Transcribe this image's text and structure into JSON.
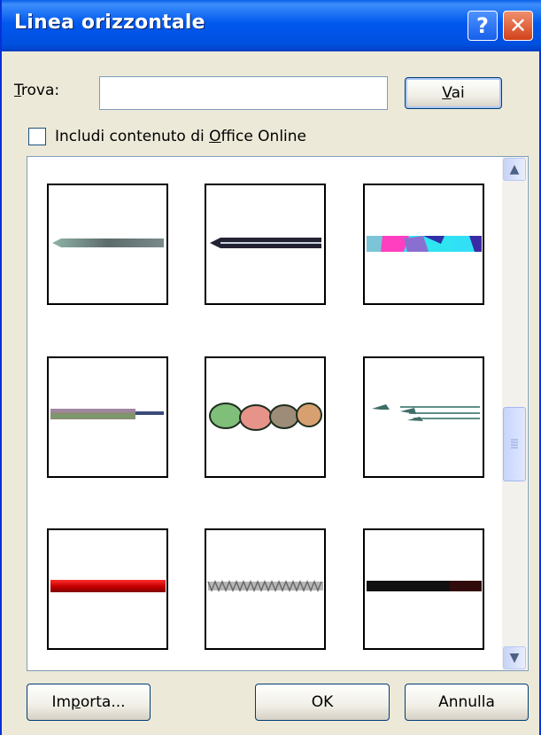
{
  "window": {
    "title": "Linea orizzontale"
  },
  "titlebar_buttons": {
    "help": "?",
    "close": "✕"
  },
  "search": {
    "label_prefix": "",
    "label_access": "T",
    "label_rest": "rova:",
    "value": "",
    "go_access": "V",
    "go_rest": "ai"
  },
  "office_online": {
    "checked": false,
    "label_before": "Includi contenuto di ",
    "label_access": "O",
    "label_after": "ffice Online"
  },
  "gallery": {
    "items": [
      {
        "name": "gradient-arrow-line"
      },
      {
        "name": "double-arrow-line"
      },
      {
        "name": "colorful-blocks-line"
      },
      {
        "name": "speckled-line"
      },
      {
        "name": "leaves-line"
      },
      {
        "name": "swoosh-lines"
      },
      {
        "name": "red-bar-line"
      },
      {
        "name": "zigzag-line"
      },
      {
        "name": "black-bar-line"
      }
    ]
  },
  "scrollbar": {
    "up_icon": "▲",
    "down_icon": "▼"
  },
  "buttons": {
    "import_access_before": "Im",
    "import_access": "p",
    "import_after": "orta...",
    "ok": "OK",
    "cancel": "Annulla"
  },
  "colors": {
    "title_blue": "#0058ee",
    "close_red": "#d2421a",
    "button_border": "#003c74"
  }
}
